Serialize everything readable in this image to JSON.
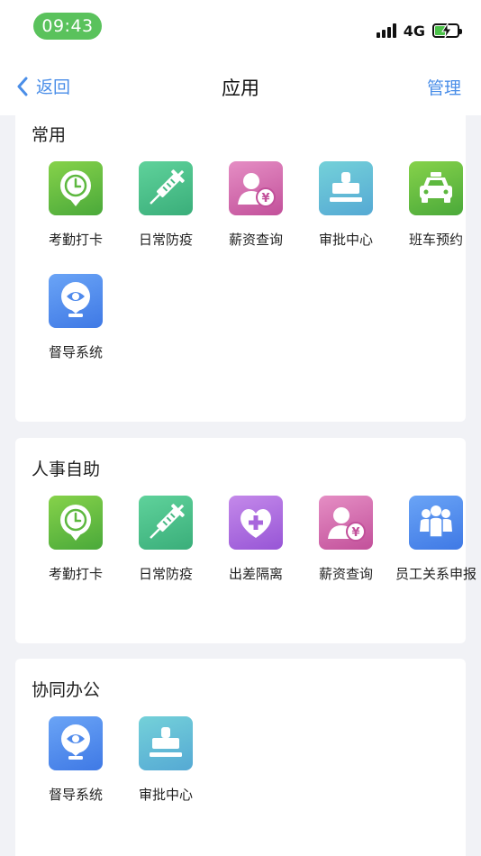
{
  "status": {
    "time": "09:43",
    "network": "4G"
  },
  "nav": {
    "back_label": "返回",
    "title": "应用",
    "manage_label": "管理"
  },
  "sections": [
    {
      "title": "常用",
      "apps": [
        {
          "label": "考勤打卡",
          "icon": "clock-pin-icon",
          "color": "#5db83f"
        },
        {
          "label": "日常防疫",
          "icon": "syringe-icon",
          "color": "#45b883"
        },
        {
          "label": "薪资查询",
          "icon": "salary-person-icon",
          "color": "#d06aae"
        },
        {
          "label": "审批中心",
          "icon": "stamp-icon",
          "color": "#62bcd6"
        },
        {
          "label": "班车预约",
          "icon": "taxi-icon",
          "color": "#5db83f"
        },
        {
          "label": "督导系统",
          "icon": "eye-pin-icon",
          "color": "#4f8aec"
        }
      ]
    },
    {
      "title": "人事自助",
      "apps": [
        {
          "label": "考勤打卡",
          "icon": "clock-pin-icon",
          "color": "#5db83f"
        },
        {
          "label": "日常防疫",
          "icon": "syringe-icon",
          "color": "#45b883"
        },
        {
          "label": "出差隔离",
          "icon": "heart-plus-icon",
          "color": "#a866dc"
        },
        {
          "label": "薪资查询",
          "icon": "salary-person-icon",
          "color": "#d06aae"
        },
        {
          "label": "员工关系申报",
          "icon": "people-group-icon",
          "color": "#4f8aec"
        }
      ]
    },
    {
      "title": "协同办公",
      "apps": [
        {
          "label": "督导系统",
          "icon": "eye-pin-icon",
          "color": "#4f8aec"
        },
        {
          "label": "审批中心",
          "icon": "stamp-icon",
          "color": "#62bcd6"
        }
      ]
    }
  ]
}
